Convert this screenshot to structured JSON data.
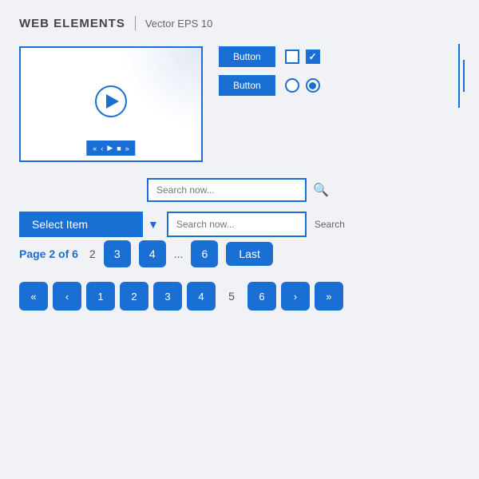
{
  "header": {
    "title": "WEB ELEMENTS",
    "subtitle": "Vector EPS 10"
  },
  "video": {
    "controls": [
      "«",
      "‹",
      "▶",
      "■",
      "»"
    ]
  },
  "buttons": {
    "btn1": "Button",
    "btn2": "Button"
  },
  "search": {
    "placeholder1": "Search now...",
    "placeholder2": "Search now...",
    "search_label": "Search",
    "select_label": "Select Item"
  },
  "pagination1": {
    "page_info": "Page 2 of 6",
    "current": "2",
    "pages": [
      "3",
      "4",
      "6"
    ],
    "dots": "...",
    "last": "Last"
  },
  "pagination2": {
    "first": "«",
    "prev": "‹",
    "pages": [
      "1",
      "2",
      "3",
      "4"
    ],
    "active": "5",
    "page6": "6",
    "next": "›",
    "last": "»"
  }
}
